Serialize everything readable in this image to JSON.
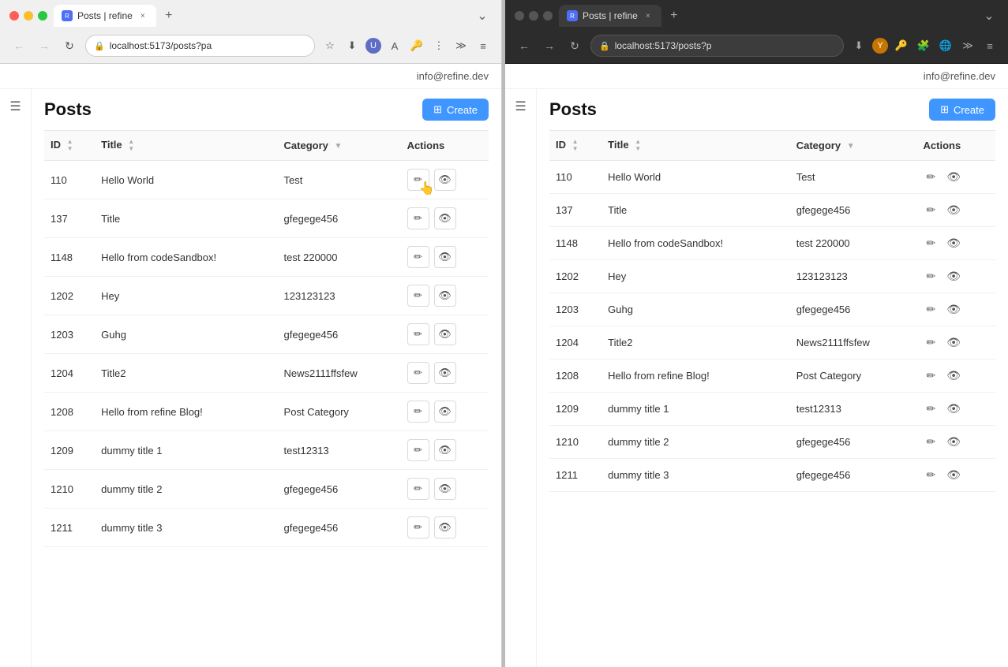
{
  "left_window": {
    "tab_title": "Posts | refine",
    "address": "localhost:5173/posts?pa",
    "user_email": "info@refine.dev",
    "page_title": "Posts",
    "create_btn": "Create",
    "columns": [
      {
        "label": "ID",
        "sortable": true
      },
      {
        "label": "Title",
        "sortable": true
      },
      {
        "label": "Category",
        "filterable": true
      },
      {
        "label": "Actions",
        "sortable": false
      }
    ],
    "rows": [
      {
        "id": "110",
        "title": "Hello World",
        "category": "Test"
      },
      {
        "id": "137",
        "title": "Title",
        "category": "gfegege456"
      },
      {
        "id": "1148",
        "title": "Hello from codeSandbox!",
        "category": "test 220000"
      },
      {
        "id": "1202",
        "title": "Hey",
        "category": "123123123"
      },
      {
        "id": "1203",
        "title": "Guhg",
        "category": "gfegege456"
      },
      {
        "id": "1204",
        "title": "Title2",
        "category": "News2111ffsfew"
      },
      {
        "id": "1208",
        "title": "Hello from refine Blog!",
        "category": "Post Category"
      },
      {
        "id": "1209",
        "title": "dummy title 1",
        "category": "test12313"
      },
      {
        "id": "1210",
        "title": "dummy title 2",
        "category": "gfegege456"
      },
      {
        "id": "1211",
        "title": "dummy title 3",
        "category": "gfegege456"
      }
    ]
  },
  "right_window": {
    "tab_title": "Posts | refine",
    "address": "localhost:5173/posts?p",
    "user_email": "info@refine.dev",
    "page_title": "Posts",
    "create_btn": "Create",
    "columns": [
      {
        "label": "ID",
        "sortable": true
      },
      {
        "label": "Title",
        "sortable": true
      },
      {
        "label": "Category",
        "filterable": true
      },
      {
        "label": "Actions",
        "sortable": false
      }
    ],
    "rows": [
      {
        "id": "110",
        "title": "Hello World",
        "category": "Test"
      },
      {
        "id": "137",
        "title": "Title",
        "category": "gfegege456"
      },
      {
        "id": "1148",
        "title": "Hello from codeSandbox!",
        "category": "test 220000"
      },
      {
        "id": "1202",
        "title": "Hey",
        "category": "123123123"
      },
      {
        "id": "1203",
        "title": "Guhg",
        "category": "gfegege456"
      },
      {
        "id": "1204",
        "title": "Title2",
        "category": "News2111ffsfew"
      },
      {
        "id": "1208",
        "title": "Hello from refine Blog!",
        "category": "Post Category"
      },
      {
        "id": "1209",
        "title": "dummy title 1",
        "category": "test12313"
      },
      {
        "id": "1210",
        "title": "dummy title 2",
        "category": "gfegege456"
      },
      {
        "id": "1211",
        "title": "dummy title 3",
        "category": "gfegege456"
      }
    ]
  },
  "icons": {
    "edit": "✏",
    "show": "👁",
    "plus": "+",
    "menu": "☰",
    "close": "×",
    "new_tab": "+",
    "overflow": "⌄",
    "back": "←",
    "forward": "→",
    "reload": "↻",
    "lock": "🔒",
    "star": "☆",
    "download": "⬇",
    "extensions": "🧩",
    "translate": "A",
    "more": "⋮",
    "sort_asc": "▲",
    "sort_desc": "▼",
    "filter": "▼",
    "table_icon": "⊞"
  }
}
